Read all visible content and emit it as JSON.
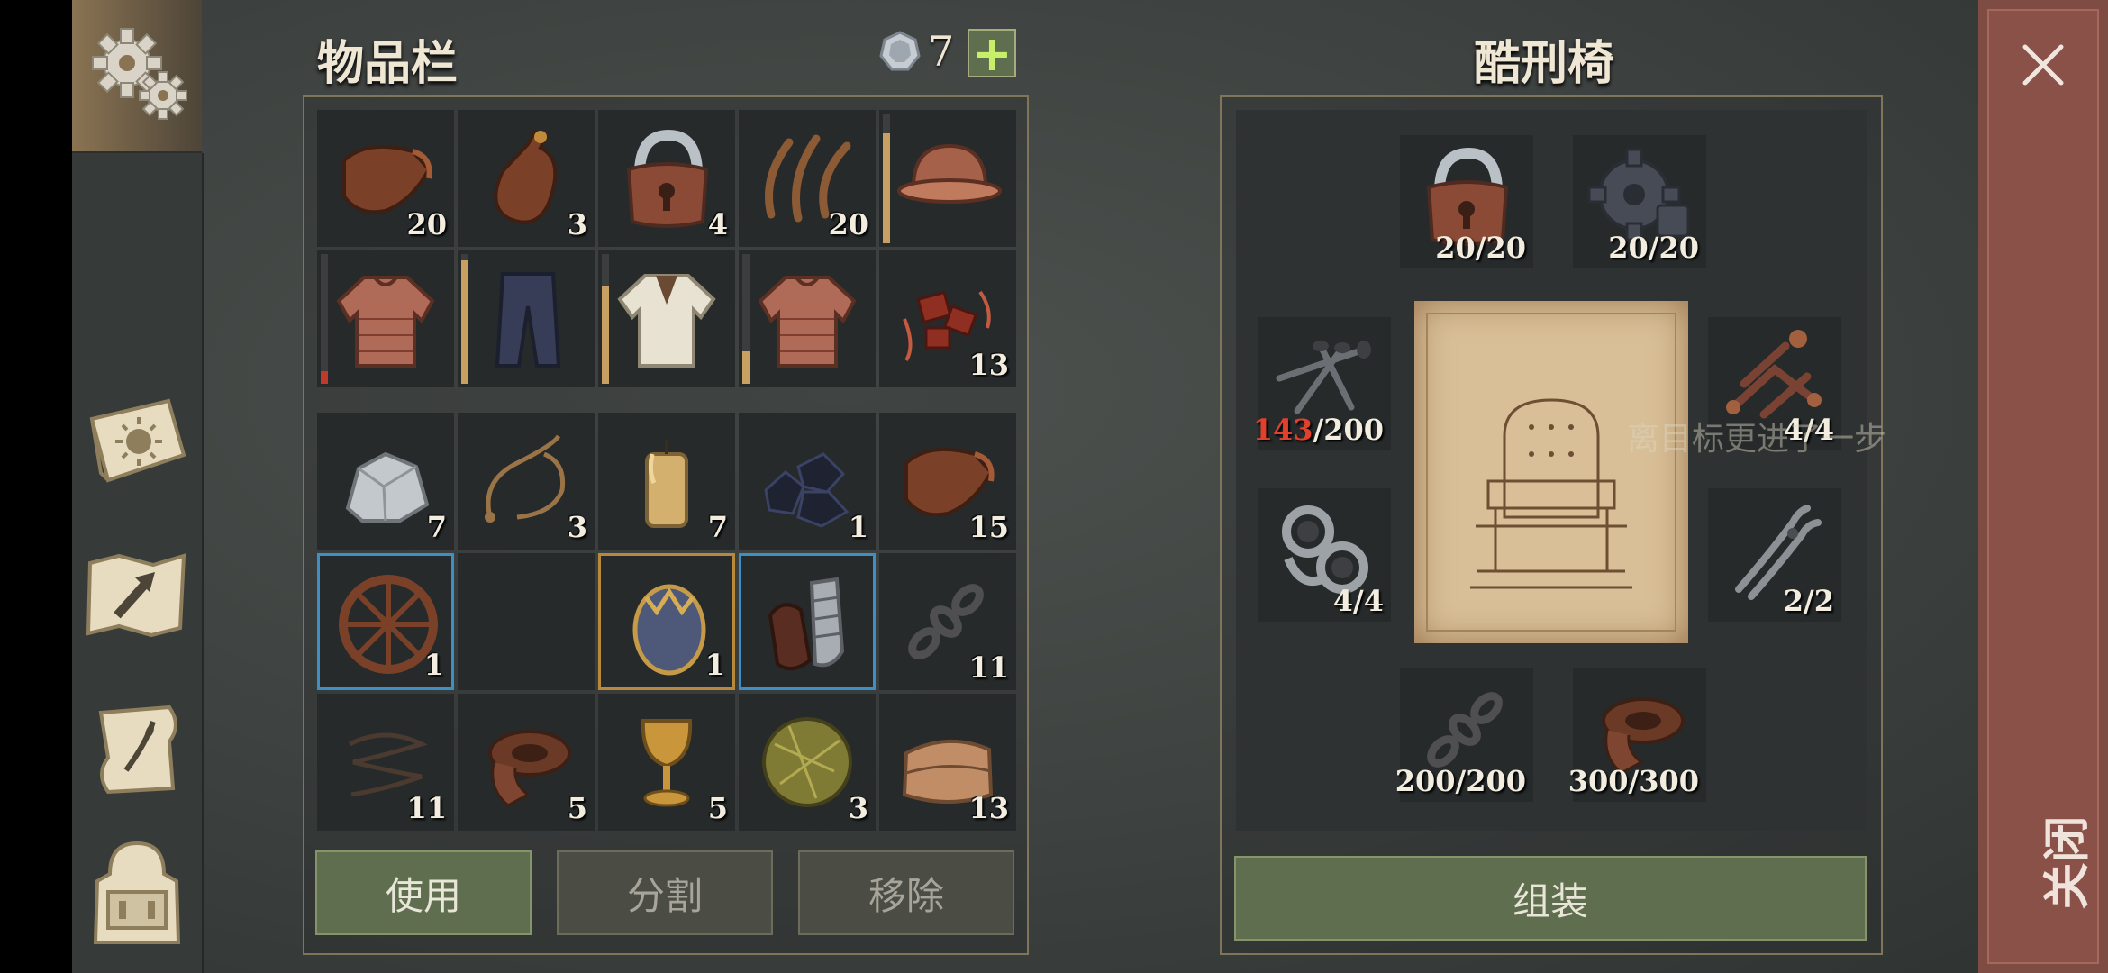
{
  "inventory": {
    "title": "物品栏",
    "currency_count": "7",
    "add_label": "+",
    "rows": [
      [
        {
          "icon": "leather-scrap-icon",
          "qty": "20"
        },
        {
          "icon": "flask-icon",
          "qty": "3"
        },
        {
          "icon": "padlock-icon",
          "qty": "4"
        },
        {
          "icon": "sinew-icon",
          "qty": "20"
        },
        {
          "icon": "helmet-icon",
          "qty": "",
          "durability": 0.85
        }
      ],
      [
        {
          "icon": "jacket-icon",
          "qty": "",
          "durability": 0.1
        },
        {
          "icon": "pants-icon",
          "qty": "",
          "durability": 0.95
        },
        {
          "icon": "shirt-icon",
          "qty": "",
          "durability": 0.75
        },
        {
          "icon": "jacket-icon",
          "qty": "",
          "durability": 0.25
        },
        {
          "icon": "raw-meat-icon",
          "qty": "13"
        }
      ],
      [
        {
          "icon": "iron-ore-icon",
          "qty": "7"
        },
        {
          "icon": "rope-icon",
          "qty": "3"
        },
        {
          "icon": "candle-icon",
          "qty": "7"
        },
        {
          "icon": "coal-icon",
          "qty": "1"
        },
        {
          "icon": "leather-scrap-icon",
          "qty": "15"
        }
      ],
      [
        {
          "icon": "wheel-icon",
          "qty": "1",
          "sel": "blue"
        },
        {
          "icon": "",
          "qty": ""
        },
        {
          "icon": "egg-icon",
          "qty": "1",
          "sel": "gold"
        },
        {
          "icon": "armored-gloves-icon",
          "qty": "",
          "sel": "blue"
        },
        {
          "icon": "chain-icon",
          "qty": "11"
        }
      ],
      [
        {
          "icon": "wire-icon",
          "qty": "11"
        },
        {
          "icon": "leather-roll-icon",
          "qty": "5"
        },
        {
          "icon": "goblet-icon",
          "qty": "5"
        },
        {
          "icon": "grass-ball-icon",
          "qty": "3"
        },
        {
          "icon": "fabric-icon",
          "qty": "13"
        }
      ]
    ],
    "buttons": {
      "use": "使用",
      "split": "分割",
      "remove": "移除"
    }
  },
  "crafting": {
    "title": "酷刑椅",
    "blueprint_icon": "torture-chair-blueprint-icon",
    "tooltip": "离目标更进了一步",
    "slots": {
      "padlock": {
        "icon": "padlock-icon",
        "qty": "20/20"
      },
      "gear": {
        "icon": "gear-part-icon",
        "qty": "20/20"
      },
      "nails": {
        "icon": "nails-icon",
        "have": "143",
        "need": "/200"
      },
      "clamp": {
        "icon": "clamp-icon",
        "qty": "4/4"
      },
      "shackles": {
        "icon": "shackles-icon",
        "qty": "4/4"
      },
      "pliers": {
        "icon": "pliers-icon",
        "qty": "2/2"
      },
      "chain": {
        "icon": "chain-icon",
        "qty": "200/200"
      },
      "leather": {
        "icon": "leather-roll-icon",
        "qty": "300/300"
      }
    },
    "assemble_label": "组装"
  },
  "close_label": "关闭",
  "sidebar": {
    "icons": [
      "settings-gear-icon",
      "journal-sun-icon",
      "map-icon",
      "scroll-icon",
      "backpack-icon"
    ]
  },
  "colors": {
    "accent_green": "#5f6e4e",
    "close_red": "#8a5148",
    "missing_red": "#e0402c"
  }
}
